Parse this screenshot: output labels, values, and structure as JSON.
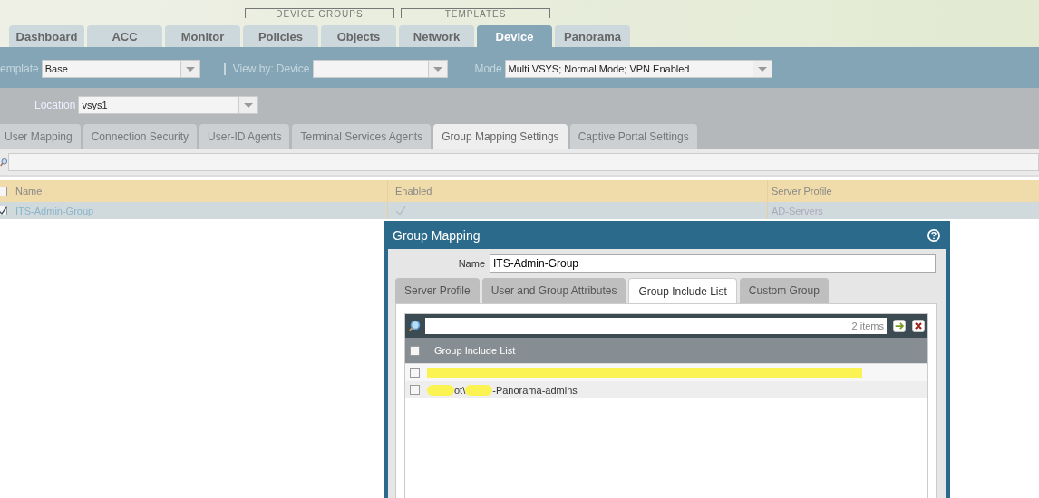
{
  "top_nav": [
    {
      "kind": "tab",
      "label": "Dashboard",
      "selected": false
    },
    {
      "kind": "tab",
      "label": "ACC",
      "selected": false
    },
    {
      "kind": "tab",
      "label": "Monitor",
      "selected": false
    },
    {
      "kind": "group",
      "label": "DEVICE GROUPS",
      "tabs": [
        {
          "label": "Policies",
          "selected": false
        },
        {
          "label": "Objects",
          "selected": false
        }
      ]
    },
    {
      "kind": "group",
      "label": "TEMPLATES",
      "tabs": [
        {
          "label": "Network",
          "selected": false
        },
        {
          "label": "Device",
          "selected": true
        }
      ]
    },
    {
      "kind": "tab",
      "label": "Panorama",
      "selected": false
    }
  ],
  "context_bar": {
    "template_label": "emplate",
    "template_value": "Base",
    "view_by_label": "View by:",
    "device_label": "Device",
    "mode_label": "Mode",
    "mode_value": "Multi VSYS; Normal Mode; VPN Enabled"
  },
  "location": {
    "label": "Location",
    "value": "vsys1"
  },
  "sub_tabs": [
    {
      "label": "User Mapping",
      "selected": false
    },
    {
      "label": "Connection Security",
      "selected": false
    },
    {
      "label": "User-ID Agents",
      "selected": false
    },
    {
      "label": "Terminal Services Agents",
      "selected": false
    },
    {
      "label": "Group Mapping Settings",
      "selected": true
    },
    {
      "label": "Captive Portal Settings",
      "selected": false
    }
  ],
  "table": {
    "columns": [
      "Name",
      "Enabled",
      "Server Profile"
    ],
    "header_checked": false,
    "rows": [
      {
        "checked": true,
        "name": "ITS-Admin-Group",
        "enabled": true,
        "server_profile": "AD-Servers"
      }
    ]
  },
  "dialog": {
    "title": "Group Mapping",
    "name_label": "Name",
    "name_value": "ITS-Admin-Group",
    "tabs": [
      {
        "label": "Server Profile",
        "selected": false
      },
      {
        "label": "User and Group Attributes",
        "selected": false
      },
      {
        "label": "Group Include List",
        "selected": true
      },
      {
        "label": "Custom Group",
        "selected": false
      }
    ],
    "list": {
      "count": "2 items",
      "column": "Group Include List",
      "header_checked": false,
      "rows": [
        {
          "checked": false,
          "segments": [
            {
              "kind": "redaction"
            }
          ]
        },
        {
          "checked": false,
          "segments": [
            {
              "kind": "redaction"
            },
            {
              "kind": "text",
              "text": "ot\\"
            },
            {
              "kind": "redaction"
            },
            {
              "kind": "text",
              "text": "-Panorama-admins"
            }
          ]
        }
      ]
    }
  }
}
